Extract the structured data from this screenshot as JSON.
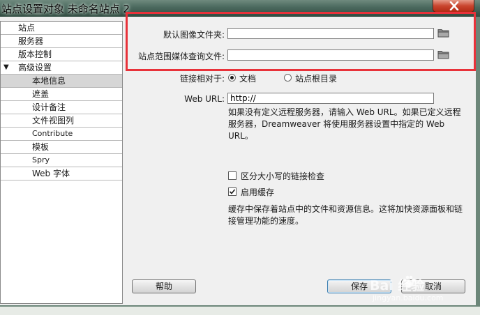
{
  "window": {
    "title": "站点设置对象 未命名站点 2"
  },
  "nav": {
    "items": [
      {
        "label": "站点"
      },
      {
        "label": "服务器"
      },
      {
        "label": "版本控制"
      },
      {
        "label": "高级设置",
        "expander": "▼"
      },
      {
        "label": "本地信息"
      },
      {
        "label": "遮盖"
      },
      {
        "label": "设计备注"
      },
      {
        "label": "文件视图列"
      },
      {
        "label": "Contribute"
      },
      {
        "label": "模板"
      },
      {
        "label": "Spry"
      },
      {
        "label": "Web 字体"
      }
    ],
    "selected": "本地信息"
  },
  "local_info": {
    "default_image_folder_label": "默认图像文件夹:",
    "default_image_folder_value": "",
    "media_query_file_label": "站点范围媒体查询文件:",
    "media_query_file_value": "",
    "links_relative_label": "链接相对于:",
    "radio_document_label": "文档",
    "radio_site_root_label": "站点根目录",
    "links_relative_selected": "文档",
    "web_url_label": "Web URL:",
    "web_url_value": "http://",
    "web_url_help": "如果没有定义远程服务器，请输入 Web URL。如果已定义远程服务器，Dreamweaver 将使用服务器设置中指定的 Web URL。",
    "case_sensitive_label": "区分大小写的链接检查",
    "case_sensitive_checked": false,
    "enable_cache_label": "启用缓存",
    "enable_cache_checked": true,
    "cache_help": "缓存中保存着站点中的文件和资源信息。这将加快资源面板和链接管理功能的速度。"
  },
  "buttons": {
    "help": "帮助",
    "save": "保存",
    "cancel": "取消"
  },
  "watermark": {
    "brand": "Bai 经验",
    "url": "jingyan.baidu.com"
  },
  "colors": {
    "highlight_border": "#e8323a",
    "close_button": "#c9452e",
    "selected_nav": "#d6d6d6"
  },
  "icons": [
    "close-icon",
    "folder-icon",
    "expander-triangle-icon",
    "checkmark-icon",
    "baidu-paw-icon"
  ]
}
